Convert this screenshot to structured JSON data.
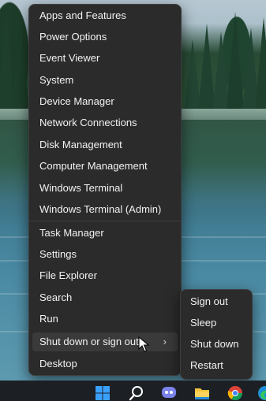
{
  "menu": {
    "items": [
      {
        "label": "Apps and Features"
      },
      {
        "label": "Power Options"
      },
      {
        "label": "Event Viewer"
      },
      {
        "label": "System"
      },
      {
        "label": "Device Manager"
      },
      {
        "label": "Network Connections"
      },
      {
        "label": "Disk Management"
      },
      {
        "label": "Computer Management"
      },
      {
        "label": "Windows Terminal"
      },
      {
        "label": "Windows Terminal (Admin)"
      },
      {
        "label": "Task Manager"
      },
      {
        "label": "Settings"
      },
      {
        "label": "File Explorer"
      },
      {
        "label": "Search"
      },
      {
        "label": "Run"
      },
      {
        "label": "Shut down or sign out",
        "has_submenu": true,
        "chevron": "›"
      },
      {
        "label": "Desktop"
      }
    ]
  },
  "submenu": {
    "items": [
      {
        "label": "Sign out"
      },
      {
        "label": "Sleep"
      },
      {
        "label": "Shut down"
      },
      {
        "label": "Restart"
      }
    ]
  },
  "taskbar": {
    "icons": [
      "windows-start-icon",
      "search-icon",
      "teams-chat-icon",
      "file-explorer-icon",
      "chrome-icon",
      "edge-icon"
    ]
  },
  "colors": {
    "menu_bg": "#2b2b2b",
    "menu_text": "#f2f2f2",
    "hover_bg": "#3a3a3a",
    "taskbar_bg": "#1c1f24",
    "windows_blue": "#3aa0ff"
  }
}
